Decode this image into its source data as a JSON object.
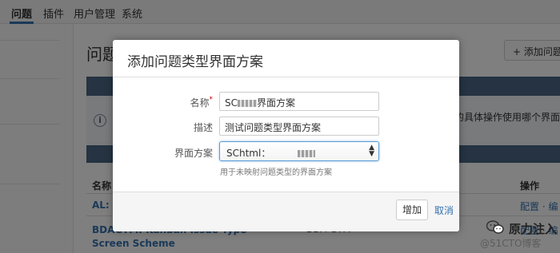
{
  "nav": {
    "items": [
      "问题",
      "插件",
      "用户管理",
      "系统"
    ]
  },
  "page": {
    "title": "问题",
    "add_button": "+ 添加问题",
    "info_text": "的具体操作使用哪个界面方",
    "table": {
      "col_name": "名称",
      "col_ops": "操作",
      "rows": [
        {
          "name": "AL: S",
          "ops": "配置 · 编"
        },
        {
          "name": "BDAGTM: Kanban Issue Type Screen Scheme",
          "project": "• BDA GTM",
          "ops": "配置 · 编"
        }
      ]
    }
  },
  "dialog": {
    "title": "添加问题类型界面方案",
    "name_label": "名称",
    "name_prefix": "SC",
    "name_suffix": "界面方案",
    "desc_label": "描述",
    "desc_value": "测试问题类型界面方案",
    "scheme_label": "界面方案",
    "scheme_value": "SChtml：",
    "help_text": "用于未映射问题类型的界面方案",
    "add_button": "增加",
    "cancel_link": "取消"
  },
  "watermark": {
    "brand": "原力注入",
    "sub": "@51CTO博客"
  },
  "colors": {
    "link": "#3572b0",
    "banner": "#4a6785",
    "overlay": "rgba(0,0,0,0.5)"
  }
}
